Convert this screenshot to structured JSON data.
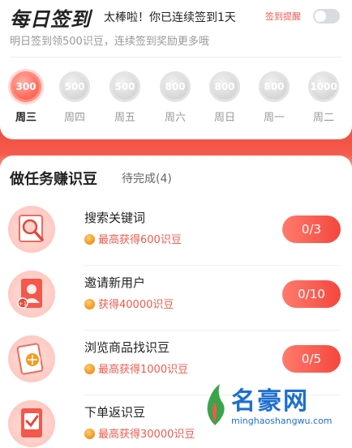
{
  "checkin": {
    "title": "每日签到",
    "streak": "太棒啦！你已连续签到1天",
    "reminder_label": "签到提醒",
    "subtitle": "明日签到领500识豆，连续签到奖励更多哦",
    "days": [
      {
        "amount": "300",
        "label": "周三",
        "active": true
      },
      {
        "amount": "500",
        "label": "周四",
        "active": false
      },
      {
        "amount": "500",
        "label": "周五",
        "active": false
      },
      {
        "amount": "800",
        "label": "周六",
        "active": false
      },
      {
        "amount": "800",
        "label": "周日",
        "active": false
      },
      {
        "amount": "800",
        "label": "周一",
        "active": false
      },
      {
        "amount": "1000",
        "label": "周二",
        "active": false
      }
    ]
  },
  "tasks": {
    "title": "做任务赚识豆",
    "pending": "待完成(4)",
    "items": [
      {
        "name": "搜索关键词",
        "reward": "最高获得600识豆",
        "progress": "0/3",
        "icon": "search-magnifier-icon"
      },
      {
        "name": "邀请新用户",
        "reward": "获得40000识豆",
        "progress": "0/10",
        "icon": "invite-user-icon"
      },
      {
        "name": "浏览商品找识豆",
        "reward": "最高获得1000识豆",
        "progress": "0/5",
        "icon": "browse-goods-icon"
      },
      {
        "name": "下单返识豆",
        "reward": "最高获得30000识豆",
        "progress": "",
        "icon": "order-check-icon"
      }
    ]
  },
  "watermark": {
    "main": "名豪网",
    "sub": "minghaoshangwu.com"
  },
  "colors": {
    "accent": "#f04a40",
    "reward_text": "#f05a4c"
  }
}
